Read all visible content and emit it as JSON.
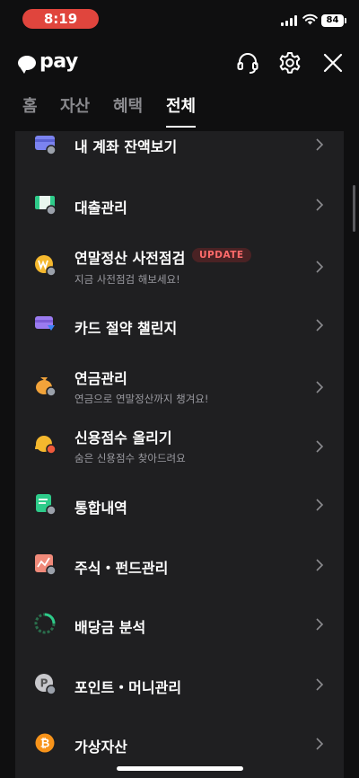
{
  "status_bar": {
    "time": "8:19",
    "battery": "84"
  },
  "header": {
    "logo_text": "pay"
  },
  "tabs": [
    {
      "label": "홈"
    },
    {
      "label": "자산"
    },
    {
      "label": "혜택"
    },
    {
      "label": "전체"
    }
  ],
  "menu_items": [
    {
      "title": "내 계좌 잔액보기",
      "icon": "account-card-icon"
    },
    {
      "title": "대출관리",
      "icon": "loan-icon"
    },
    {
      "title": "연말정산 사전점검",
      "subtitle": "지금 사전점검 해보세요!",
      "badge": "UPDATE",
      "icon": "won-coin-icon"
    },
    {
      "title": "카드 절약 챌린지",
      "icon": "card-saving-icon"
    },
    {
      "title": "연금관리",
      "subtitle": "연금으로 연말정산까지 챙겨요!",
      "icon": "pension-bag-icon"
    },
    {
      "title": "신용점수 올리기",
      "subtitle": "숨은 신용점수 찾아드려요",
      "icon": "credit-score-icon"
    },
    {
      "title": "통합내역",
      "icon": "history-doc-icon"
    },
    {
      "title": "주식・펀드관리",
      "icon": "stock-chart-icon"
    },
    {
      "title": "배당금 분석",
      "icon": "dividend-pie-icon"
    },
    {
      "title": "포인트・머니관리",
      "icon": "point-coin-icon"
    },
    {
      "title": "가상자산",
      "icon": "bitcoin-icon"
    }
  ],
  "colors": {
    "accent_red": "#e0453d",
    "panel_bg": "#1f1f21",
    "badge_text": "#ff6b6b"
  }
}
